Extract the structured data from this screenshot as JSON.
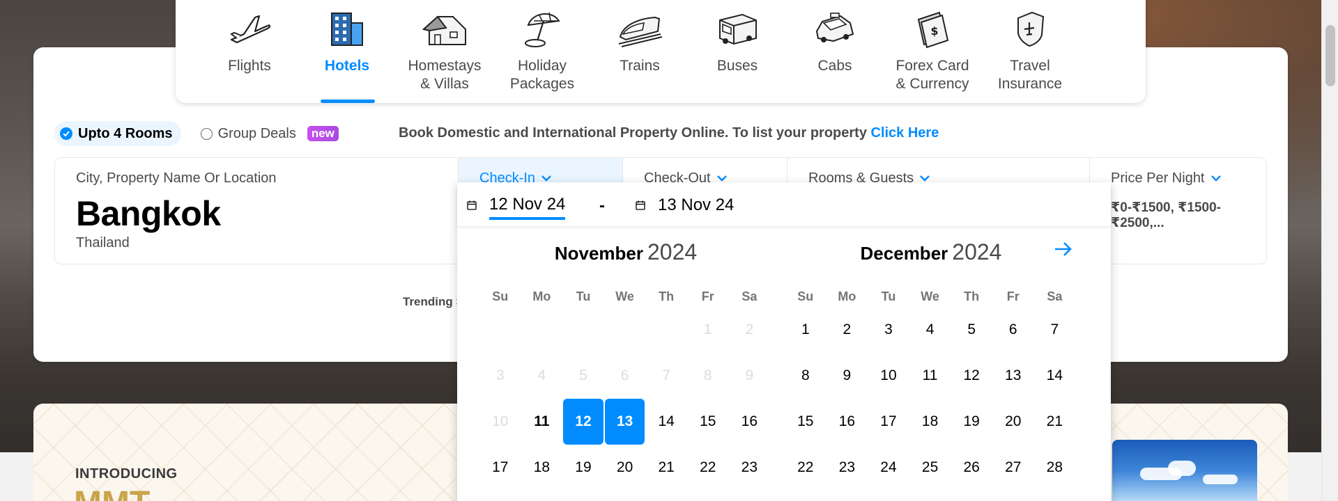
{
  "nav": [
    {
      "name": "nav-flights",
      "label": "Flights",
      "icon": "airplane-icon"
    },
    {
      "name": "nav-hotels",
      "label": "Hotels",
      "icon": "hotel-building-icon",
      "active": true
    },
    {
      "name": "nav-homestays",
      "label": "Homestays\n& Villas",
      "icon": "house-icon"
    },
    {
      "name": "nav-holiday",
      "label": "Holiday\nPackages",
      "icon": "beach-umbrella-icon"
    },
    {
      "name": "nav-trains",
      "label": "Trains",
      "icon": "train-icon"
    },
    {
      "name": "nav-buses",
      "label": "Buses",
      "icon": "bus-icon"
    },
    {
      "name": "nav-cabs",
      "label": "Cabs",
      "icon": "cab-icon"
    },
    {
      "name": "nav-forex",
      "label": "Forex Card\n& Currency",
      "icon": "forex-card-icon"
    },
    {
      "name": "nav-insurance",
      "label": "Travel\nInsurance",
      "icon": "insurance-shield-icon"
    }
  ],
  "options": {
    "rooms_label": "Upto 4 Rooms",
    "group_label": "Group Deals",
    "new_badge": "new"
  },
  "promo": {
    "text": "Book Domestic and International Property Online. To list your property ",
    "link": "Click Here"
  },
  "search": {
    "city_label": "City, Property Name Or Location",
    "city": "Bangkok",
    "country": "Thailand",
    "checkin_label": "Check-In",
    "checkout_label": "Check-Out",
    "rooms_label": "Rooms & Guests",
    "price_label": "Price Per Night",
    "price_value": "₹0-₹1500, ₹1500-₹2500,..."
  },
  "trending_label": "Trending S",
  "picker": {
    "start_date": "12 Nov 24",
    "separator": "-",
    "end_date": "13 Nov 24",
    "weekdays": [
      "Su",
      "Mo",
      "Tu",
      "We",
      "Th",
      "Fr",
      "Sa"
    ],
    "months": [
      {
        "month": "November",
        "year": "2024",
        "days": [
          {
            "d": ""
          },
          {
            "d": ""
          },
          {
            "d": ""
          },
          {
            "d": ""
          },
          {
            "d": ""
          },
          {
            "d": "1",
            "state": "disabled"
          },
          {
            "d": "2",
            "state": "disabled"
          },
          {
            "d": "3",
            "state": "disabled"
          },
          {
            "d": "4",
            "state": "disabled"
          },
          {
            "d": "5",
            "state": "disabled"
          },
          {
            "d": "6",
            "state": "disabled"
          },
          {
            "d": "7",
            "state": "disabled"
          },
          {
            "d": "8",
            "state": "disabled"
          },
          {
            "d": "9",
            "state": "disabled"
          },
          {
            "d": "10",
            "state": "disabled"
          },
          {
            "d": "11",
            "state": "today"
          },
          {
            "d": "12",
            "state": "sel"
          },
          {
            "d": "13",
            "state": "sel"
          },
          {
            "d": "14"
          },
          {
            "d": "15"
          },
          {
            "d": "16"
          },
          {
            "d": "17"
          },
          {
            "d": "18"
          },
          {
            "d": "19"
          },
          {
            "d": "20"
          },
          {
            "d": "21"
          },
          {
            "d": "22"
          },
          {
            "d": "23"
          }
        ]
      },
      {
        "month": "December",
        "year": "2024",
        "days": [
          {
            "d": "1"
          },
          {
            "d": "2"
          },
          {
            "d": "3"
          },
          {
            "d": "4"
          },
          {
            "d": "5"
          },
          {
            "d": "6"
          },
          {
            "d": "7"
          },
          {
            "d": "8"
          },
          {
            "d": "9"
          },
          {
            "d": "10"
          },
          {
            "d": "11"
          },
          {
            "d": "12"
          },
          {
            "d": "13"
          },
          {
            "d": "14"
          },
          {
            "d": "15"
          },
          {
            "d": "16"
          },
          {
            "d": "17"
          },
          {
            "d": "18"
          },
          {
            "d": "19"
          },
          {
            "d": "20"
          },
          {
            "d": "21"
          },
          {
            "d": "22"
          },
          {
            "d": "23"
          },
          {
            "d": "24"
          },
          {
            "d": "25"
          },
          {
            "d": "26"
          },
          {
            "d": "27"
          },
          {
            "d": "28"
          }
        ]
      }
    ]
  },
  "lower": {
    "introducing": "INTRODUCING",
    "logo_text": "MMT"
  },
  "colors": {
    "accent": "#008cff",
    "badge": "#c74ff1",
    "logo_gold": "#c9a44a"
  }
}
